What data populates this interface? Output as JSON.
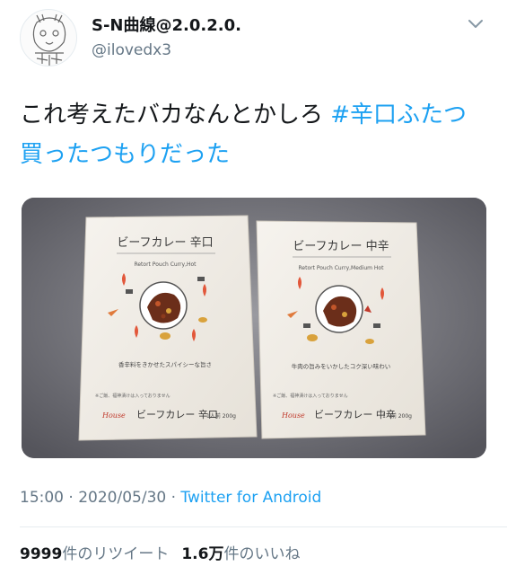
{
  "user": {
    "display_name": "S-N曲線@2.0.2.0.",
    "handle": "@ilovedx3"
  },
  "tweet": {
    "text": "これ考えたバカなんとかしろ ",
    "hashtag": "#辛口ふたつ買ったつもりだった"
  },
  "photo": {
    "left_box": {
      "title": "ビーフカレー 辛口",
      "subtitle": "Retort Pouch Curry,Hot",
      "tagline": "香辛料をきかせたスパイシーな旨さ",
      "note": "※ご飯、福神漬けは入っておりません",
      "brand": "House",
      "bottom_name": "ビーフカレー 辛口",
      "serving": "1人前 200g"
    },
    "right_box": {
      "title": "ビーフカレー 中辛",
      "subtitle": "Retort Pouch Curry,Medium Hot",
      "tagline": "牛肉の旨みをいかしたコク深い味わい",
      "note": "※ご飯、福神漬けは入っておりません",
      "brand": "House",
      "bottom_name": "ビーフカレー 中辛",
      "serving": "1人前 200g"
    }
  },
  "meta": {
    "time": "15:00",
    "separator": "·",
    "date": "2020/05/30",
    "source": "Twitter for Android"
  },
  "stats": {
    "retweet_count": "9999",
    "retweet_label": "件のリツイート",
    "like_count": "1.6万",
    "like_label": "件のいいね"
  },
  "colors": {
    "link": "#1da1f2",
    "text": "#14171a",
    "muted": "#657786",
    "box_bg": "#f1ede6",
    "curry": "#6b2e1a",
    "flame": "#e2573a"
  },
  "icons": [
    "chevron-down-icon"
  ]
}
